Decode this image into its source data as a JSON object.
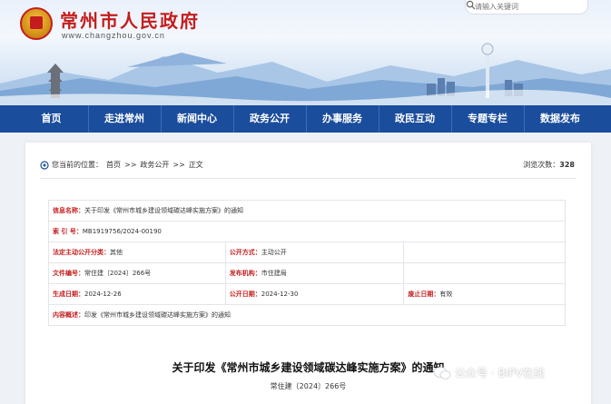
{
  "header": {
    "site_name": "常州市人民政府",
    "domain": "www.changzhou.gov.cn",
    "search_placeholder": "请输入关键词"
  },
  "nav": [
    "首页",
    "走进常州",
    "新闻中心",
    "政务公开",
    "办事服务",
    "政民互动",
    "专题专栏",
    "数据发布"
  ],
  "breadcrumb": {
    "prefix": "您当前的位置：",
    "items": [
      "首页",
      ">>",
      "政务公开",
      ">>",
      "正文"
    ]
  },
  "views": {
    "label": "浏览次数：",
    "count": "328"
  },
  "meta": {
    "info_name_label": "信息名称：",
    "info_name": "关于印发《常州市城乡建设领域碳达峰实施方案》的通知",
    "index_label": "索 引 号：",
    "index": "MB1919756/2024-00190",
    "legal_label": "法定主动公开分类：",
    "legal": "其他",
    "open_mode_label": "公开方式：",
    "open_mode": "主动公开",
    "doc_no_label": "文件编号：",
    "doc_no": "常住建〔2024〕266号",
    "issuer_label": "发布机构：",
    "issuer": "市住建局",
    "created_label": "生成日期：",
    "created": "2024-12-26",
    "published_label": "公开日期：",
    "published": "2024-12-30",
    "abolish_label": "废止日期：",
    "abolish": "有效",
    "summary_label": "内容概述：",
    "summary": "印发《常州市城乡建设领域碳达峰实施方案》的通知"
  },
  "document": {
    "title": "关于印发《常州市城乡建设领域碳达峰实施方案》的通知",
    "number": "常住建〔2024〕266号"
  },
  "watermark": "公众号 · BIPV在线"
}
